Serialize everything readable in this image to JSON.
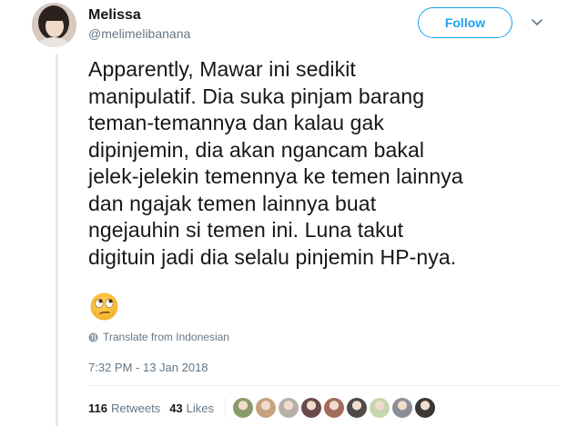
{
  "user": {
    "name": "Melissa",
    "handle": "@melimelibanana"
  },
  "follow_label": "Follow",
  "tweet": {
    "lines": [
      "Apparently, Mawar ini sedikit",
      "manipulatif. Dia suka pinjam barang",
      "teman-temannya dan kalau gak",
      "dipinjemin, dia akan ngancam bakal",
      "jelek-jelekin temennya ke temen lainnya",
      "dan ngajak temen lainnya buat",
      "ngejauhin si temen ini. Luna takut",
      "digituin jadi dia selalu pinjemin HP-nya."
    ],
    "emoji": "face-with-rolling-eyes"
  },
  "translate_label": "Translate from Indonesian",
  "timestamp": "7:32 PM - 13 Jan 2018",
  "stats": {
    "retweets_count": "116",
    "retweets_label": "Retweets",
    "likes_count": "43",
    "likes_label": "Likes"
  },
  "likers": [
    {
      "color": "#8a9a6b"
    },
    {
      "color": "#c7a27f"
    },
    {
      "color": "#b8b0a8"
    },
    {
      "color": "#6b4a4a"
    },
    {
      "color": "#a56b5a"
    },
    {
      "color": "#4d4a48"
    },
    {
      "color": "#c8d6b0"
    },
    {
      "color": "#8a8f96"
    },
    {
      "color": "#3a3836"
    }
  ],
  "colors": {
    "accent": "#1da1f2",
    "text": "#14171a",
    "muted": "#657786",
    "border": "#e6ecf0"
  }
}
